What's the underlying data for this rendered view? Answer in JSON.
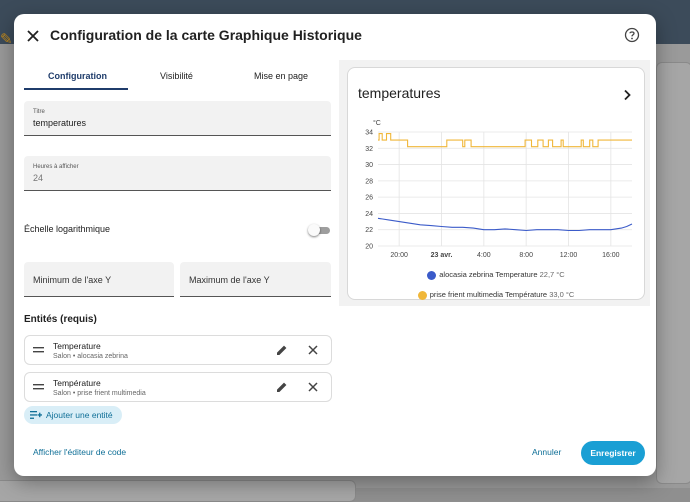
{
  "dialog": {
    "title": "Configuration de la carte Graphique Historique"
  },
  "tabs": [
    {
      "label": "Configuration",
      "active": true
    },
    {
      "label": "Visibilité",
      "active": false
    },
    {
      "label": "Mise en page",
      "active": false
    }
  ],
  "form": {
    "title_label": "Titre",
    "title_value": "temperatures",
    "hours_label": "Heures à afficher",
    "hours_value": "24",
    "log_scale_label": "Échelle logarithmique",
    "log_scale_enabled": false,
    "y_min_placeholder": "Minimum de l'axe Y",
    "y_max_placeholder": "Maximum de l'axe Y"
  },
  "entities": {
    "section_title": "Entités (requis)",
    "items": [
      {
        "name": "Temperature",
        "area": "Salon",
        "device": "alocasia zebrina",
        "separator": "•"
      },
      {
        "name": "Température",
        "area": "Salon",
        "device": "prise frient multimedia",
        "separator": "•"
      }
    ],
    "add_label": "Ajouter une entité"
  },
  "footer": {
    "code_editor_label": "Afficher l'éditeur de code",
    "cancel_label": "Annuler",
    "save_label": "Enregistrer"
  },
  "preview": {
    "card_title": "temperatures"
  },
  "colors": {
    "accent": "#1a9fd4",
    "series_1": "#3b5bc9",
    "series_2": "#f0b73a"
  },
  "chart_data": {
    "type": "line",
    "unit_label": "°C",
    "ylim": [
      20,
      34
    ],
    "yticks": [
      "34",
      "32",
      "30",
      "28",
      "26",
      "24",
      "22",
      "20"
    ],
    "xticks": [
      "20:00",
      "23 avr.",
      "4:00",
      "8:00",
      "12:00",
      "16:00"
    ],
    "x_hours": [
      -4,
      0,
      4,
      8,
      12,
      16
    ],
    "grid": true,
    "series": [
      {
        "name": "alocasia zebrina Temperature",
        "legend_value": "22,7 °C",
        "color": "#3b5bc9",
        "x": [
          -6,
          -5,
          -4,
          -3,
          -2,
          -1,
          0,
          1,
          2,
          3,
          4,
          5,
          6,
          7,
          8,
          9,
          10,
          11,
          12,
          13,
          14,
          15,
          16,
          17,
          17.5,
          18
        ],
        "y": [
          23.4,
          23.2,
          23.0,
          22.8,
          22.6,
          22.5,
          22.4,
          22.3,
          22.3,
          22.2,
          22.0,
          22.0,
          22.1,
          22.0,
          21.9,
          22.0,
          22.0,
          22.0,
          21.9,
          21.9,
          22.0,
          22.0,
          22.0,
          22.2,
          22.4,
          22.7
        ]
      },
      {
        "name": "prise frient multimedia Température",
        "legend_value": "33,0 °C",
        "color": "#f0b73a",
        "x": [
          -6,
          -5.9,
          -5.9,
          -5.6,
          -5.6,
          -5.2,
          -5.2,
          -4.8,
          -4.8,
          -3.2,
          -3.2,
          0.5,
          0.5,
          2,
          2,
          2.2,
          2.2,
          2.8,
          2.8,
          3.1,
          3.1,
          7.9,
          7.9,
          8.5,
          8.5,
          9.1,
          9.1,
          9.6,
          9.6,
          10.1,
          10.1,
          10.5,
          10.5,
          11.3,
          11.3,
          11.5,
          11.5,
          13.2,
          13.2,
          13.4,
          13.4,
          14.0,
          14.0,
          14.3,
          14.3,
          14.8,
          14.8,
          15.6,
          15.6,
          18
        ],
        "y": [
          33.0,
          33.0,
          33.8,
          33.8,
          33.0,
          33.0,
          33.8,
          33.8,
          33.0,
          33.0,
          32.2,
          32.2,
          33.0,
          33.0,
          32.2,
          32.2,
          33.0,
          33.0,
          32.2,
          32.2,
          32.2,
          32.2,
          33.0,
          33.0,
          32.2,
          32.2,
          33.0,
          33.0,
          32.2,
          32.2,
          33.0,
          33.0,
          32.2,
          32.2,
          33.0,
          33.0,
          32.2,
          32.2,
          33.0,
          33.0,
          32.2,
          32.2,
          33.0,
          33.0,
          32.2,
          32.2,
          33.0,
          33.0,
          33.0,
          33.0
        ]
      }
    ]
  }
}
